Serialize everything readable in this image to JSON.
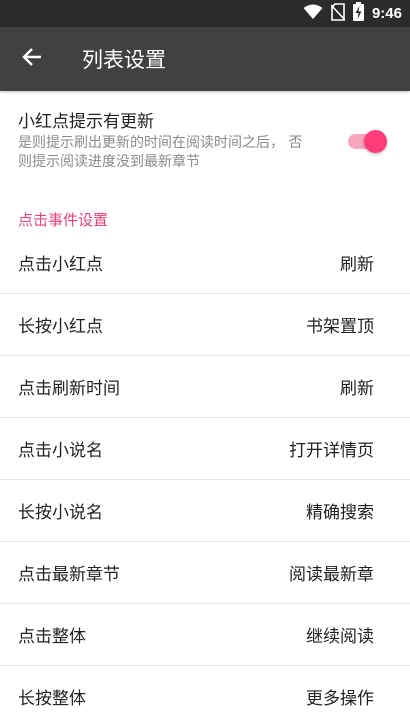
{
  "status_bar": {
    "time": "9:46",
    "icons": [
      "wifi-icon",
      "no-sim-icon",
      "battery-charging-icon"
    ]
  },
  "app_bar": {
    "back_icon": "arrow-left-icon",
    "title": "列表设置"
  },
  "toggle_setting": {
    "title": "小红点提示有更新",
    "description": "是则提示刷出更新的时间在阅读时间之后， 否则提示阅读进度没到最新章节",
    "enabled": true,
    "accent_color": "#ff3d7a"
  },
  "section": {
    "header": "点击事件设置",
    "header_color": "#e8437a"
  },
  "list": {
    "items": [
      {
        "label": "点击小红点",
        "value": "刷新"
      },
      {
        "label": "长按小红点",
        "value": "书架置顶"
      },
      {
        "label": "点击刷新时间",
        "value": "刷新"
      },
      {
        "label": "点击小说名",
        "value": "打开详情页"
      },
      {
        "label": "长按小说名",
        "value": "精确搜索"
      },
      {
        "label": "点击最新章节",
        "value": "阅读最新章"
      },
      {
        "label": "点击整体",
        "value": "继续阅读"
      },
      {
        "label": "长按整体",
        "value": "更多操作"
      }
    ]
  }
}
